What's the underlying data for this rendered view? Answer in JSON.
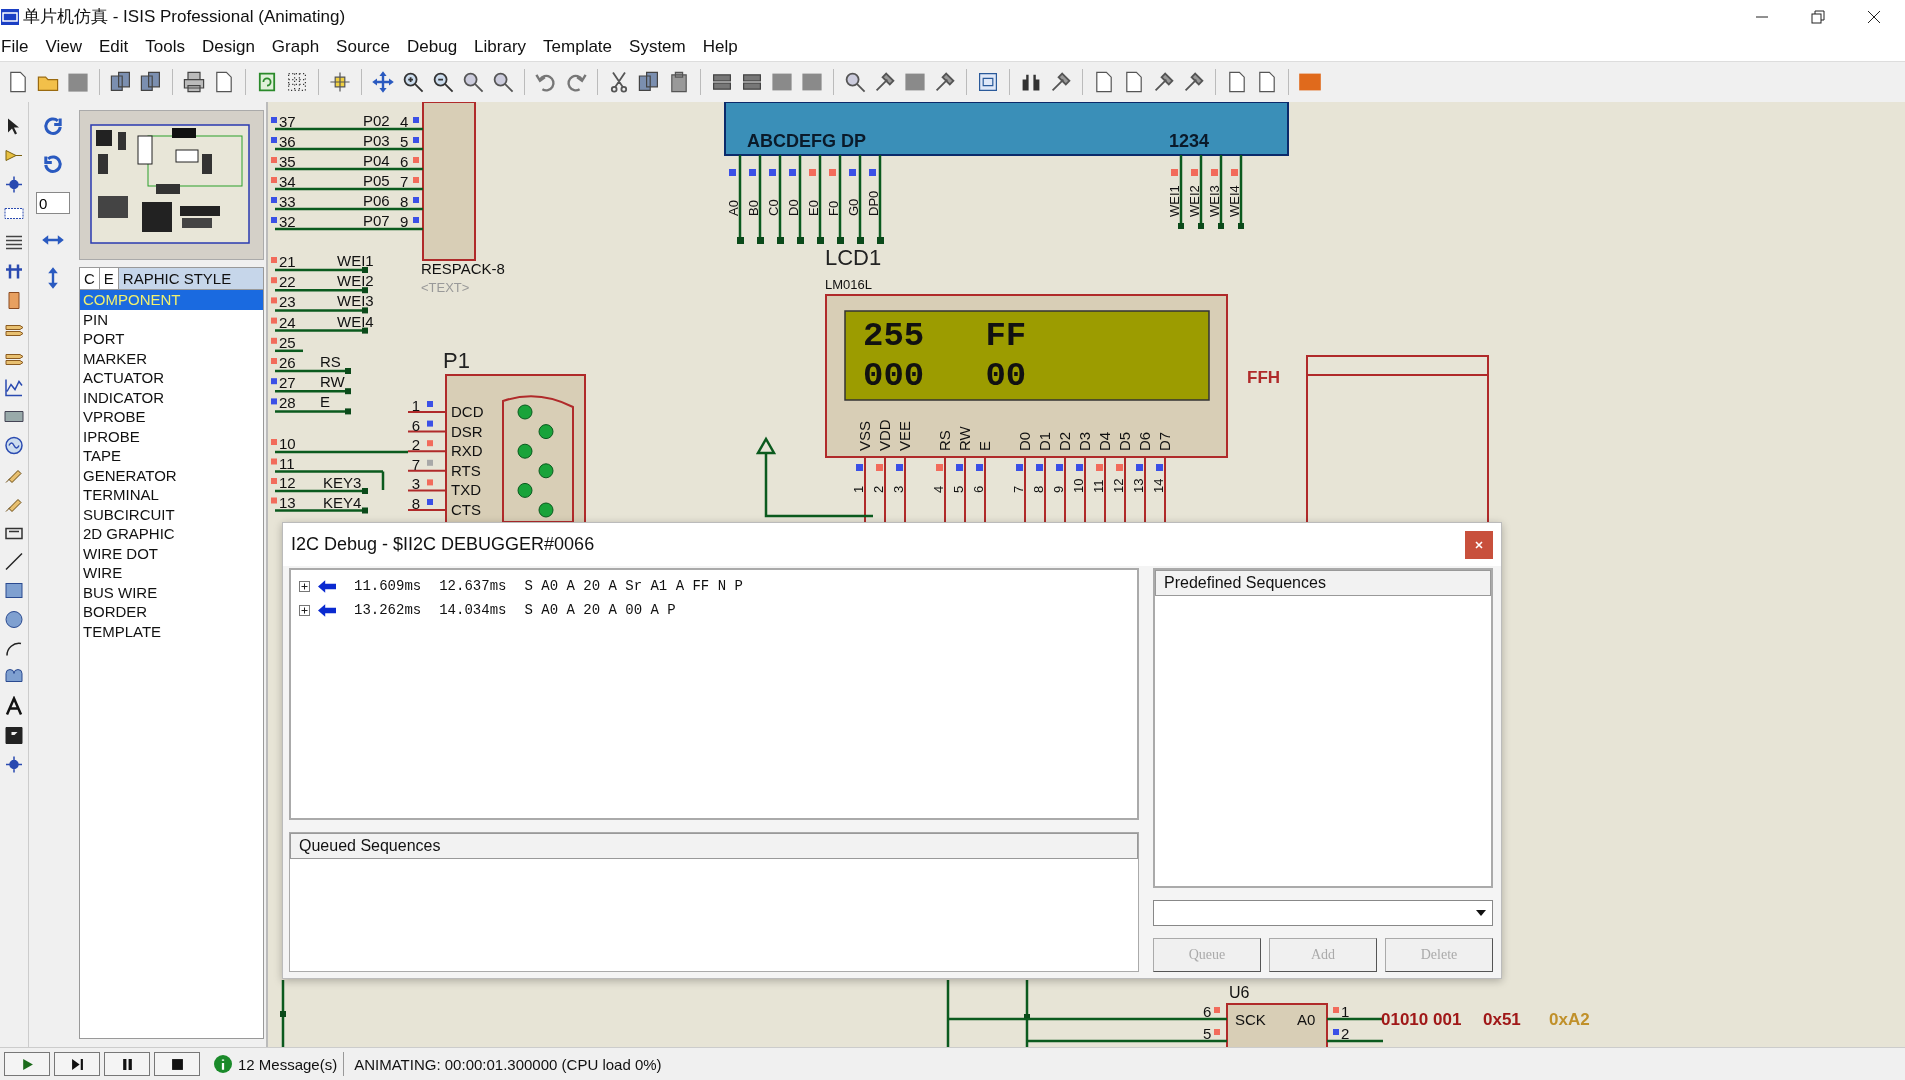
{
  "window": {
    "title": "单片机仿真 - ISIS Professional (Animating)"
  },
  "menu": [
    "File",
    "View",
    "Edit",
    "Tools",
    "Design",
    "Graph",
    "Source",
    "Debug",
    "Library",
    "Template",
    "System",
    "Help"
  ],
  "rotation_field": {
    "value": "0"
  },
  "selector": {
    "tabs": [
      {
        "label": "C",
        "selected": false
      },
      {
        "label": "E",
        "selected": false
      },
      {
        "label": "RAPHIC STYLE",
        "selected": true
      }
    ],
    "items": [
      {
        "label": "COMPONENT",
        "selected": true
      },
      {
        "label": "PIN",
        "selected": false
      },
      {
        "label": "PORT",
        "selected": false
      },
      {
        "label": "MARKER",
        "selected": false
      },
      {
        "label": "ACTUATOR",
        "selected": false
      },
      {
        "label": "INDICATOR",
        "selected": false
      },
      {
        "label": "VPROBE",
        "selected": false
      },
      {
        "label": "IPROBE",
        "selected": false
      },
      {
        "label": "TAPE",
        "selected": false
      },
      {
        "label": "GENERATOR",
        "selected": false
      },
      {
        "label": "TERMINAL",
        "selected": false
      },
      {
        "label": "SUBCIRCUIT",
        "selected": false
      },
      {
        "label": "2D GRAPHIC",
        "selected": false
      },
      {
        "label": "WIRE DOT",
        "selected": false
      },
      {
        "label": "WIRE",
        "selected": false
      },
      {
        "label": "BUS WIRE",
        "selected": false
      },
      {
        "label": "BORDER",
        "selected": false
      },
      {
        "label": "TEMPLATE",
        "selected": false
      }
    ]
  },
  "schematic": {
    "respack": {
      "name": "RESPACK-8",
      "text": "<TEXT>"
    },
    "respack_rows": [
      {
        "number": "37",
        "color": "#3b50e6",
        "label": "P02",
        "target": {
          "number": "4",
          "color": "#3b50e6"
        }
      },
      {
        "number": "36",
        "color": "#3b50e6",
        "label": "P03",
        "target": {
          "number": "5",
          "color": "#3b50e6"
        }
      },
      {
        "number": "35",
        "color": "#f26b5b",
        "label": "P04",
        "target": {
          "number": "6",
          "color": "#f26b5b"
        }
      },
      {
        "number": "34",
        "color": "#f26b5b",
        "label": "P05",
        "target": {
          "number": "7",
          "color": "#f26b5b"
        }
      },
      {
        "number": "33",
        "color": "#3b50e6",
        "label": "P06",
        "target": {
          "number": "8",
          "color": "#3b50e6"
        }
      },
      {
        "number": "32",
        "color": "#3b50e6",
        "label": "P07",
        "target": {
          "number": "9",
          "color": "#3b50e6"
        }
      }
    ],
    "net_rows": [
      {
        "number": "21",
        "color": "#f26b5b",
        "kind": "net",
        "label": "WEI1"
      },
      {
        "number": "22",
        "color": "#f26b5b",
        "kind": "net",
        "label": "WEI2"
      },
      {
        "number": "23",
        "color": "#f26b5b",
        "kind": "net",
        "label": "WEI3"
      },
      {
        "number": "24",
        "color": "#f26b5b",
        "kind": "net",
        "label": "WEI4"
      },
      {
        "number": "25",
        "color": "#f26b5b",
        "kind": "stub"
      },
      {
        "number": "26",
        "color": "#f26b5b",
        "kind": "short",
        "label": "RS"
      },
      {
        "number": "27",
        "color": "#3b50e6",
        "kind": "short",
        "label": "RW"
      },
      {
        "number": "28",
        "color": "#3b50e6",
        "kind": "short",
        "label": "E"
      }
    ],
    "io_rows": [
      {
        "number": "10",
        "color": "#f26b5b",
        "kind": "direct"
      },
      {
        "number": "11",
        "color": "#f26b5b",
        "kind": "jog"
      },
      {
        "number": "12",
        "color": "#f26b5b",
        "kind": "net",
        "label": "KEY3"
      },
      {
        "number": "13",
        "color": "#f26b5b",
        "kind": "net",
        "label": "KEY4"
      }
    ],
    "connector": {
      "name": "P1",
      "pins": [
        {
          "number": "1",
          "label": "DCD",
          "color": "#3b50e6"
        },
        {
          "number": "6",
          "label": "DSR",
          "color": "#3b50e6"
        },
        {
          "number": "2",
          "label": "RXD",
          "color": "#f26b5b"
        },
        {
          "number": "7",
          "label": "RTS",
          "color": "#a8a8a8"
        },
        {
          "number": "3",
          "label": "TXD",
          "color": "#f26b5b"
        },
        {
          "number": "8",
          "label": "CTS",
          "color": "#3b50e6"
        }
      ]
    },
    "display": {
      "segments_label": "ABCDEFG DP",
      "digits_label": "1234",
      "segment_pins": [
        {
          "label": "A0",
          "color": "#3b50e6"
        },
        {
          "label": "B0",
          "color": "#3b50e6"
        },
        {
          "label": "C0",
          "color": "#3b50e6"
        },
        {
          "label": "D0",
          "color": "#3b50e6"
        },
        {
          "label": "E0",
          "color": "#f26b5b"
        },
        {
          "label": "F0",
          "color": "#f26b5b"
        },
        {
          "label": "G0",
          "color": "#3b50e6"
        },
        {
          "label": "DP0",
          "color": "#3b50e6"
        }
      ],
      "digit_pins": [
        {
          "label": "WEI1",
          "color": "#f26b5b"
        },
        {
          "label": "WEI2",
          "color": "#f26b5b"
        },
        {
          "label": "WEI3",
          "color": "#f26b5b"
        },
        {
          "label": "WEI4",
          "color": "#f26b5b"
        }
      ]
    },
    "lcd": {
      "name": "LCD1",
      "part": "LM016L",
      "lines": [
        "255   FF",
        "000   00"
      ],
      "pins": [
        {
          "label": "VSS",
          "number": "1",
          "color": "#3b50e6"
        },
        {
          "label": "VDD",
          "number": "2",
          "color": "#f26b5b"
        },
        {
          "label": "VEE",
          "number": "3",
          "color": "#3b50e6"
        },
        {
          "label": "RS",
          "number": "4",
          "color": "#f26b5b"
        },
        {
          "label": "RW",
          "number": "5",
          "color": "#3b50e6"
        },
        {
          "label": "E",
          "number": "6",
          "color": "#3b50e6"
        },
        {
          "label": "D0",
          "number": "7",
          "color": "#3b50e6"
        },
        {
          "label": "D1",
          "number": "8",
          "color": "#3b50e6"
        },
        {
          "label": "D2",
          "number": "9",
          "color": "#3b50e6"
        },
        {
          "label": "D3",
          "number": "10",
          "color": "#3b50e6"
        },
        {
          "label": "D4",
          "number": "11",
          "color": "#f26b5b"
        },
        {
          "label": "D5",
          "number": "12",
          "color": "#f26b5b"
        },
        {
          "label": "D6",
          "number": "13",
          "color": "#3b50e6"
        },
        {
          "label": "D7",
          "number": "14",
          "color": "#3b50e6"
        }
      ]
    },
    "port_value": "FFH",
    "eeprom": {
      "name": "U6",
      "left_pins": [
        {
          "number": "6",
          "label": "SCK",
          "color": "#f26b5b"
        },
        {
          "number": "5",
          "color": "#f26b5b"
        }
      ],
      "right_pins": [
        {
          "number": "1",
          "label": "A0",
          "color": "#f26b5b"
        },
        {
          "number": "2",
          "color": "#3b50e6"
        }
      ]
    },
    "address_notes": [
      {
        "text": "01010 001",
        "color": "#a01818"
      },
      {
        "text": "0x51",
        "color": "#a01818"
      },
      {
        "text": "0xA2",
        "color": "#c0902a"
      }
    ]
  },
  "dialog": {
    "title": "I2C Debug - $II2C DEBUGGER#0066",
    "transactions": [
      {
        "expanded": false,
        "start": "11.609ms",
        "end": "12.637ms",
        "sequence": "S A0 A 20 A Sr A1 A FF N P"
      },
      {
        "expanded": false,
        "start": "13.262ms",
        "end": "14.034ms",
        "sequence": "S A0 A 20 A 00 A P"
      }
    ],
    "queued_header": "Queued Sequences",
    "predefined_header": "Predefined Sequences",
    "buttons": [
      {
        "label": "Queue",
        "disabled": true
      },
      {
        "label": "Add",
        "disabled": true
      },
      {
        "label": "Delete",
        "disabled": true
      }
    ]
  },
  "status_bar": {
    "messages": "12 Message(s)",
    "status": "ANIMATING: 00:00:01.300000 (CPU load 0%)"
  }
}
